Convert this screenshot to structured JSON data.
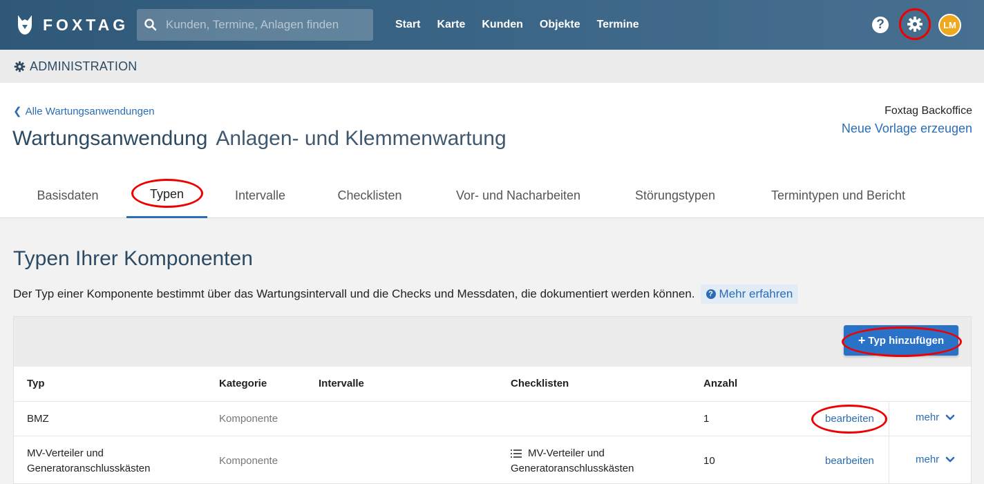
{
  "app": {
    "logo_text": "FOXTAG",
    "search_placeholder": "Kunden, Termine, Anlagen finden",
    "nav": [
      "Start",
      "Karte",
      "Kunden",
      "Objekte",
      "Termine"
    ],
    "help_symbol": "?",
    "avatar_initials": "LM",
    "icons": [
      "search-icon",
      "help-icon",
      "gear-icon"
    ]
  },
  "admin": {
    "label": "ADMINISTRATION"
  },
  "header": {
    "back_link": "Alle Wartungsanwendungen",
    "title": "Wartungsanwendung",
    "subtitle": "Anlagen- und Klemmenwartung",
    "owner": "Foxtag Backoffice",
    "template_link": "Neue Vorlage erzeugen"
  },
  "tabs": [
    "Basisdaten",
    "Typen",
    "Intervalle",
    "Checklisten",
    "Vor- und Nacharbeiten",
    "Störungstypen",
    "Termintypen und Bericht"
  ],
  "section": {
    "title": "Typen Ihrer Komponenten",
    "description": "Der Typ einer Komponente bestimmt über das Wartungsintervall und die Checks und Messdaten, die dokumentiert werden können.",
    "more_info": "Mehr erfahren",
    "add_button": "Typ hinzufügen"
  },
  "table": {
    "headers": [
      "Typ",
      "Kategorie",
      "Intervalle",
      "Checklisten",
      "Anzahl"
    ],
    "rows": [
      {
        "typ_line1": "BMZ",
        "typ_line2": "",
        "kategorie": "Komponente",
        "intervalle": "",
        "check_line1": "",
        "check_line2": "",
        "anzahl": "1",
        "edit": "bearbeiten",
        "more": "mehr"
      },
      {
        "typ_line1": "MV-Verteiler und",
        "typ_line2": "Generatoranschlusskästen",
        "kategorie": "Komponente",
        "intervalle": "",
        "check_line1": "MV-Verteiler und",
        "check_line2": "Generatoranschlusskästen",
        "anzahl": "10",
        "edit": "bearbeiten",
        "more": "mehr"
      }
    ]
  },
  "colors": {
    "accent": "#2a6db5",
    "header_bg": "#3b6586",
    "annotation": "#e00000"
  }
}
